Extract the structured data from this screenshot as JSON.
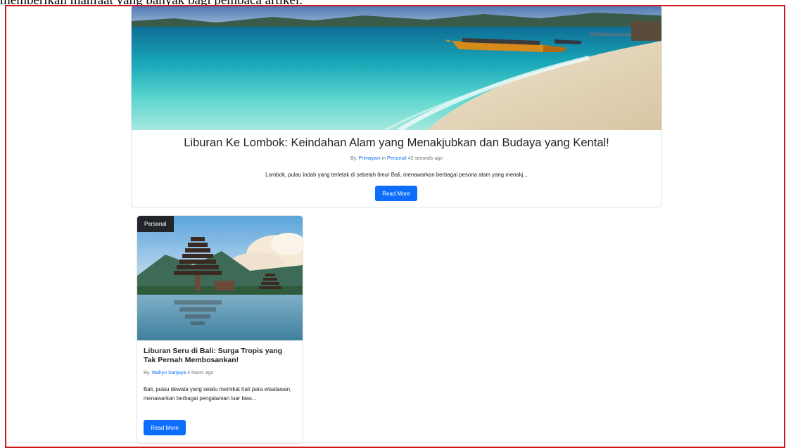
{
  "caption": "memberikan manfaat yang banyak bagi pembaca artikel.",
  "featured": {
    "title": "Liburan Ke Lombok: Keindahan Alam yang Menakjubkan dan Budaya yang Kental!",
    "by_prefix": "By.",
    "author": "Primayani",
    "in_word": "in",
    "category": "Personal",
    "time": "42 seconds ago",
    "excerpt": "Lombok, pulau indah yang terletak di sebelah timur Bali, menawarkan berbagai pesona alam yang menakj...",
    "button": "Read More"
  },
  "card": {
    "badge": "Personal",
    "title": "Liburan Seru di Bali: Surga Tropis yang Tak Pernah Membosankan!",
    "by_prefix": "By.",
    "author": "Wahyu Sanjaya",
    "time": "4 hours ago",
    "excerpt": "Bali, pulau dewata yang selalu memikat hati para wisatawan, menawarkan berbagai pengalaman luar bias...",
    "button": "Read More"
  },
  "colors": {
    "primary": "#0d6efd",
    "frame_border": "#d0171c",
    "badge_bg": "#212529"
  }
}
